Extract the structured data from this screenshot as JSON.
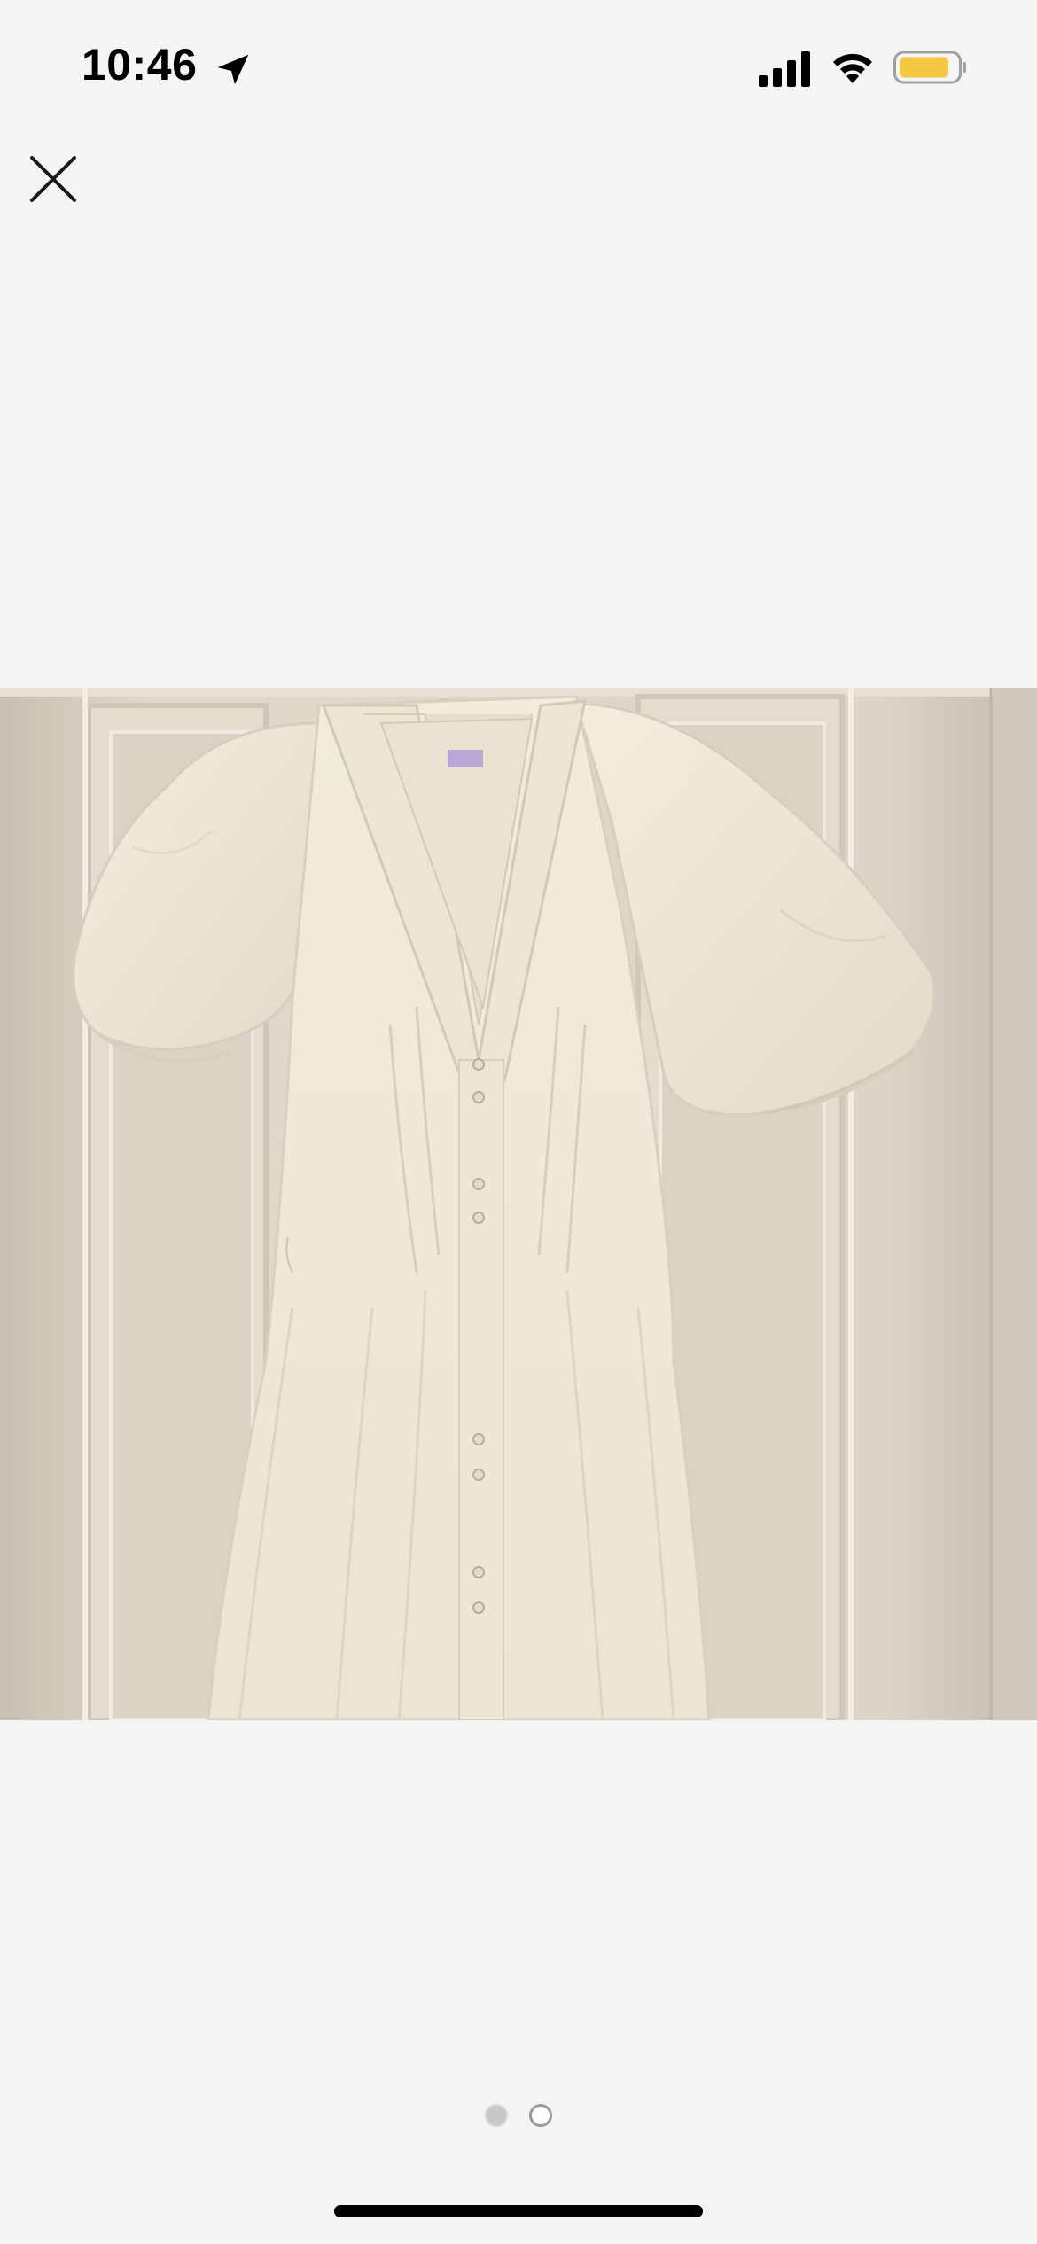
{
  "status_bar": {
    "time": "10:46",
    "icons": [
      "location-arrow-icon",
      "cellular-signal-icon",
      "wifi-icon",
      "battery-icon"
    ],
    "battery_color": "#f5c842"
  },
  "viewer": {
    "close_icon": "close-icon",
    "photo_subject": "cream-dress-photo",
    "page_count": 2,
    "current_page": 1
  },
  "colors": {
    "background": "#f4f4f3",
    "pager_active": "#c9c9c9",
    "pager_inactive": "#ffffff"
  }
}
